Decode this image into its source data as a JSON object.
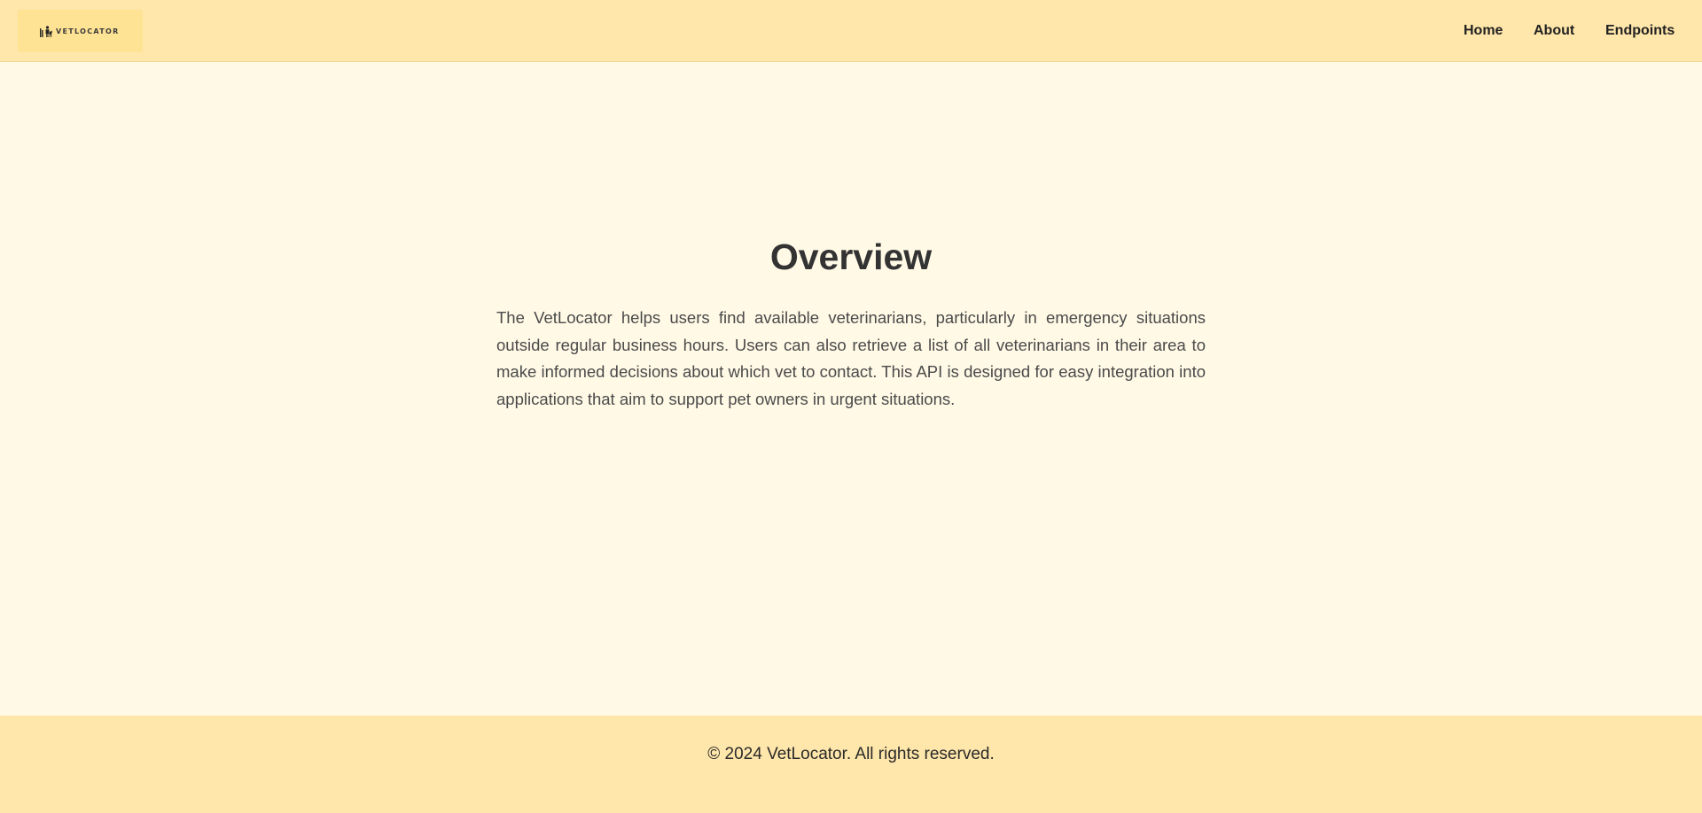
{
  "header": {
    "logo_text": "VETLOCATOR",
    "logo_icon": "vet-with-dog-icon",
    "nav": [
      {
        "label": "Home"
      },
      {
        "label": "About"
      },
      {
        "label": "Endpoints"
      }
    ]
  },
  "main": {
    "title": "Overview",
    "description": "The VetLocator helps users find available veterinarians, particularly in emergency situations outside regular business hours. Users can also retrieve a list of all veterinarians in their area to make informed decisions about which vet to contact. This API is designed for easy integration into applications that aim to support pet owners in urgent situations."
  },
  "footer": {
    "copyright": "© 2024 VetLocator. All rights reserved."
  },
  "colors": {
    "header_bg": "#ffe6aa",
    "page_bg": "#fff9e6",
    "logo_bg": "#ffe394",
    "text_dark": "#333333"
  }
}
